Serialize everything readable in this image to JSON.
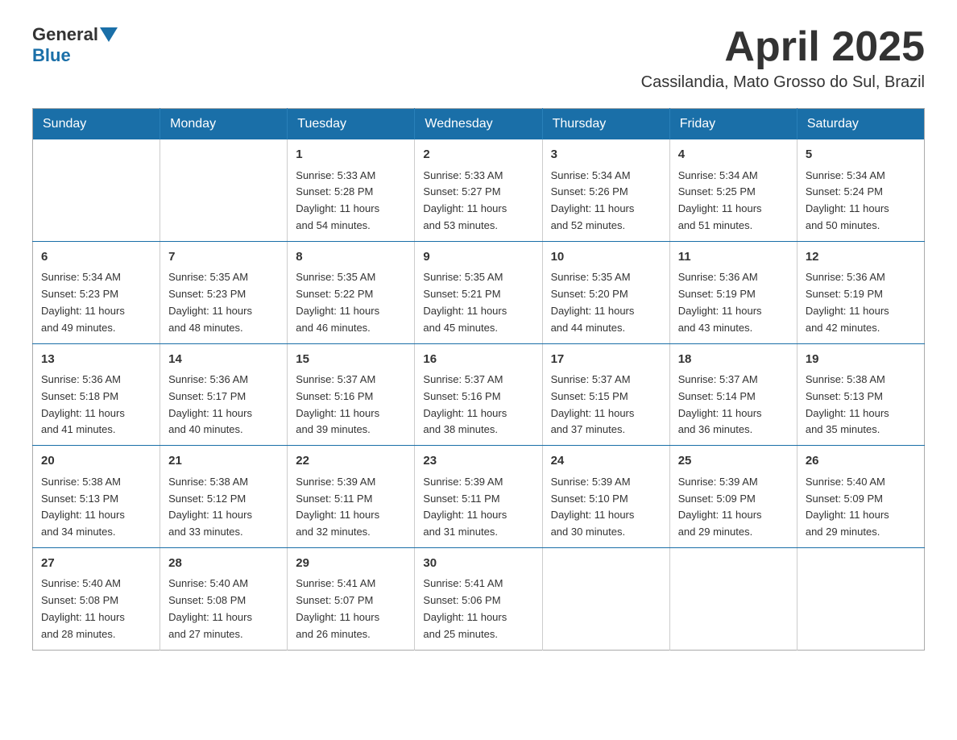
{
  "logo": {
    "general": "General",
    "blue": "Blue"
  },
  "title": {
    "month": "April 2025",
    "location": "Cassilandia, Mato Grosso do Sul, Brazil"
  },
  "weekdays": [
    "Sunday",
    "Monday",
    "Tuesday",
    "Wednesday",
    "Thursday",
    "Friday",
    "Saturday"
  ],
  "weeks": [
    [
      {
        "day": "",
        "info": ""
      },
      {
        "day": "",
        "info": ""
      },
      {
        "day": "1",
        "info": "Sunrise: 5:33 AM\nSunset: 5:28 PM\nDaylight: 11 hours\nand 54 minutes."
      },
      {
        "day": "2",
        "info": "Sunrise: 5:33 AM\nSunset: 5:27 PM\nDaylight: 11 hours\nand 53 minutes."
      },
      {
        "day": "3",
        "info": "Sunrise: 5:34 AM\nSunset: 5:26 PM\nDaylight: 11 hours\nand 52 minutes."
      },
      {
        "day": "4",
        "info": "Sunrise: 5:34 AM\nSunset: 5:25 PM\nDaylight: 11 hours\nand 51 minutes."
      },
      {
        "day": "5",
        "info": "Sunrise: 5:34 AM\nSunset: 5:24 PM\nDaylight: 11 hours\nand 50 minutes."
      }
    ],
    [
      {
        "day": "6",
        "info": "Sunrise: 5:34 AM\nSunset: 5:23 PM\nDaylight: 11 hours\nand 49 minutes."
      },
      {
        "day": "7",
        "info": "Sunrise: 5:35 AM\nSunset: 5:23 PM\nDaylight: 11 hours\nand 48 minutes."
      },
      {
        "day": "8",
        "info": "Sunrise: 5:35 AM\nSunset: 5:22 PM\nDaylight: 11 hours\nand 46 minutes."
      },
      {
        "day": "9",
        "info": "Sunrise: 5:35 AM\nSunset: 5:21 PM\nDaylight: 11 hours\nand 45 minutes."
      },
      {
        "day": "10",
        "info": "Sunrise: 5:35 AM\nSunset: 5:20 PM\nDaylight: 11 hours\nand 44 minutes."
      },
      {
        "day": "11",
        "info": "Sunrise: 5:36 AM\nSunset: 5:19 PM\nDaylight: 11 hours\nand 43 minutes."
      },
      {
        "day": "12",
        "info": "Sunrise: 5:36 AM\nSunset: 5:19 PM\nDaylight: 11 hours\nand 42 minutes."
      }
    ],
    [
      {
        "day": "13",
        "info": "Sunrise: 5:36 AM\nSunset: 5:18 PM\nDaylight: 11 hours\nand 41 minutes."
      },
      {
        "day": "14",
        "info": "Sunrise: 5:36 AM\nSunset: 5:17 PM\nDaylight: 11 hours\nand 40 minutes."
      },
      {
        "day": "15",
        "info": "Sunrise: 5:37 AM\nSunset: 5:16 PM\nDaylight: 11 hours\nand 39 minutes."
      },
      {
        "day": "16",
        "info": "Sunrise: 5:37 AM\nSunset: 5:16 PM\nDaylight: 11 hours\nand 38 minutes."
      },
      {
        "day": "17",
        "info": "Sunrise: 5:37 AM\nSunset: 5:15 PM\nDaylight: 11 hours\nand 37 minutes."
      },
      {
        "day": "18",
        "info": "Sunrise: 5:37 AM\nSunset: 5:14 PM\nDaylight: 11 hours\nand 36 minutes."
      },
      {
        "day": "19",
        "info": "Sunrise: 5:38 AM\nSunset: 5:13 PM\nDaylight: 11 hours\nand 35 minutes."
      }
    ],
    [
      {
        "day": "20",
        "info": "Sunrise: 5:38 AM\nSunset: 5:13 PM\nDaylight: 11 hours\nand 34 minutes."
      },
      {
        "day": "21",
        "info": "Sunrise: 5:38 AM\nSunset: 5:12 PM\nDaylight: 11 hours\nand 33 minutes."
      },
      {
        "day": "22",
        "info": "Sunrise: 5:39 AM\nSunset: 5:11 PM\nDaylight: 11 hours\nand 32 minutes."
      },
      {
        "day": "23",
        "info": "Sunrise: 5:39 AM\nSunset: 5:11 PM\nDaylight: 11 hours\nand 31 minutes."
      },
      {
        "day": "24",
        "info": "Sunrise: 5:39 AM\nSunset: 5:10 PM\nDaylight: 11 hours\nand 30 minutes."
      },
      {
        "day": "25",
        "info": "Sunrise: 5:39 AM\nSunset: 5:09 PM\nDaylight: 11 hours\nand 29 minutes."
      },
      {
        "day": "26",
        "info": "Sunrise: 5:40 AM\nSunset: 5:09 PM\nDaylight: 11 hours\nand 29 minutes."
      }
    ],
    [
      {
        "day": "27",
        "info": "Sunrise: 5:40 AM\nSunset: 5:08 PM\nDaylight: 11 hours\nand 28 minutes."
      },
      {
        "day": "28",
        "info": "Sunrise: 5:40 AM\nSunset: 5:08 PM\nDaylight: 11 hours\nand 27 minutes."
      },
      {
        "day": "29",
        "info": "Sunrise: 5:41 AM\nSunset: 5:07 PM\nDaylight: 11 hours\nand 26 minutes."
      },
      {
        "day": "30",
        "info": "Sunrise: 5:41 AM\nSunset: 5:06 PM\nDaylight: 11 hours\nand 25 minutes."
      },
      {
        "day": "",
        "info": ""
      },
      {
        "day": "",
        "info": ""
      },
      {
        "day": "",
        "info": ""
      }
    ]
  ]
}
